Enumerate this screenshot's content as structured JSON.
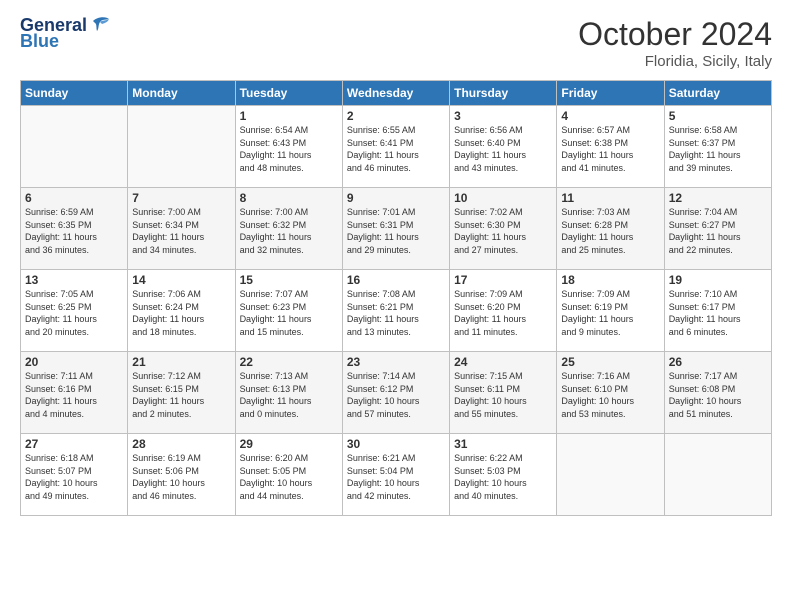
{
  "logo": {
    "text1": "General",
    "text2": "Blue"
  },
  "title": "October 2024",
  "location": "Floridia, Sicily, Italy",
  "days_header": [
    "Sunday",
    "Monday",
    "Tuesday",
    "Wednesday",
    "Thursday",
    "Friday",
    "Saturday"
  ],
  "weeks": [
    [
      {
        "day": "",
        "info": ""
      },
      {
        "day": "",
        "info": ""
      },
      {
        "day": "1",
        "info": "Sunrise: 6:54 AM\nSunset: 6:43 PM\nDaylight: 11 hours\nand 48 minutes."
      },
      {
        "day": "2",
        "info": "Sunrise: 6:55 AM\nSunset: 6:41 PM\nDaylight: 11 hours\nand 46 minutes."
      },
      {
        "day": "3",
        "info": "Sunrise: 6:56 AM\nSunset: 6:40 PM\nDaylight: 11 hours\nand 43 minutes."
      },
      {
        "day": "4",
        "info": "Sunrise: 6:57 AM\nSunset: 6:38 PM\nDaylight: 11 hours\nand 41 minutes."
      },
      {
        "day": "5",
        "info": "Sunrise: 6:58 AM\nSunset: 6:37 PM\nDaylight: 11 hours\nand 39 minutes."
      }
    ],
    [
      {
        "day": "6",
        "info": "Sunrise: 6:59 AM\nSunset: 6:35 PM\nDaylight: 11 hours\nand 36 minutes."
      },
      {
        "day": "7",
        "info": "Sunrise: 7:00 AM\nSunset: 6:34 PM\nDaylight: 11 hours\nand 34 minutes."
      },
      {
        "day": "8",
        "info": "Sunrise: 7:00 AM\nSunset: 6:32 PM\nDaylight: 11 hours\nand 32 minutes."
      },
      {
        "day": "9",
        "info": "Sunrise: 7:01 AM\nSunset: 6:31 PM\nDaylight: 11 hours\nand 29 minutes."
      },
      {
        "day": "10",
        "info": "Sunrise: 7:02 AM\nSunset: 6:30 PM\nDaylight: 11 hours\nand 27 minutes."
      },
      {
        "day": "11",
        "info": "Sunrise: 7:03 AM\nSunset: 6:28 PM\nDaylight: 11 hours\nand 25 minutes."
      },
      {
        "day": "12",
        "info": "Sunrise: 7:04 AM\nSunset: 6:27 PM\nDaylight: 11 hours\nand 22 minutes."
      }
    ],
    [
      {
        "day": "13",
        "info": "Sunrise: 7:05 AM\nSunset: 6:25 PM\nDaylight: 11 hours\nand 20 minutes."
      },
      {
        "day": "14",
        "info": "Sunrise: 7:06 AM\nSunset: 6:24 PM\nDaylight: 11 hours\nand 18 minutes."
      },
      {
        "day": "15",
        "info": "Sunrise: 7:07 AM\nSunset: 6:23 PM\nDaylight: 11 hours\nand 15 minutes."
      },
      {
        "day": "16",
        "info": "Sunrise: 7:08 AM\nSunset: 6:21 PM\nDaylight: 11 hours\nand 13 minutes."
      },
      {
        "day": "17",
        "info": "Sunrise: 7:09 AM\nSunset: 6:20 PM\nDaylight: 11 hours\nand 11 minutes."
      },
      {
        "day": "18",
        "info": "Sunrise: 7:09 AM\nSunset: 6:19 PM\nDaylight: 11 hours\nand 9 minutes."
      },
      {
        "day": "19",
        "info": "Sunrise: 7:10 AM\nSunset: 6:17 PM\nDaylight: 11 hours\nand 6 minutes."
      }
    ],
    [
      {
        "day": "20",
        "info": "Sunrise: 7:11 AM\nSunset: 6:16 PM\nDaylight: 11 hours\nand 4 minutes."
      },
      {
        "day": "21",
        "info": "Sunrise: 7:12 AM\nSunset: 6:15 PM\nDaylight: 11 hours\nand 2 minutes."
      },
      {
        "day": "22",
        "info": "Sunrise: 7:13 AM\nSunset: 6:13 PM\nDaylight: 11 hours\nand 0 minutes."
      },
      {
        "day": "23",
        "info": "Sunrise: 7:14 AM\nSunset: 6:12 PM\nDaylight: 10 hours\nand 57 minutes."
      },
      {
        "day": "24",
        "info": "Sunrise: 7:15 AM\nSunset: 6:11 PM\nDaylight: 10 hours\nand 55 minutes."
      },
      {
        "day": "25",
        "info": "Sunrise: 7:16 AM\nSunset: 6:10 PM\nDaylight: 10 hours\nand 53 minutes."
      },
      {
        "day": "26",
        "info": "Sunrise: 7:17 AM\nSunset: 6:08 PM\nDaylight: 10 hours\nand 51 minutes."
      }
    ],
    [
      {
        "day": "27",
        "info": "Sunrise: 6:18 AM\nSunset: 5:07 PM\nDaylight: 10 hours\nand 49 minutes."
      },
      {
        "day": "28",
        "info": "Sunrise: 6:19 AM\nSunset: 5:06 PM\nDaylight: 10 hours\nand 46 minutes."
      },
      {
        "day": "29",
        "info": "Sunrise: 6:20 AM\nSunset: 5:05 PM\nDaylight: 10 hours\nand 44 minutes."
      },
      {
        "day": "30",
        "info": "Sunrise: 6:21 AM\nSunset: 5:04 PM\nDaylight: 10 hours\nand 42 minutes."
      },
      {
        "day": "31",
        "info": "Sunrise: 6:22 AM\nSunset: 5:03 PM\nDaylight: 10 hours\nand 40 minutes."
      },
      {
        "day": "",
        "info": ""
      },
      {
        "day": "",
        "info": ""
      }
    ]
  ]
}
